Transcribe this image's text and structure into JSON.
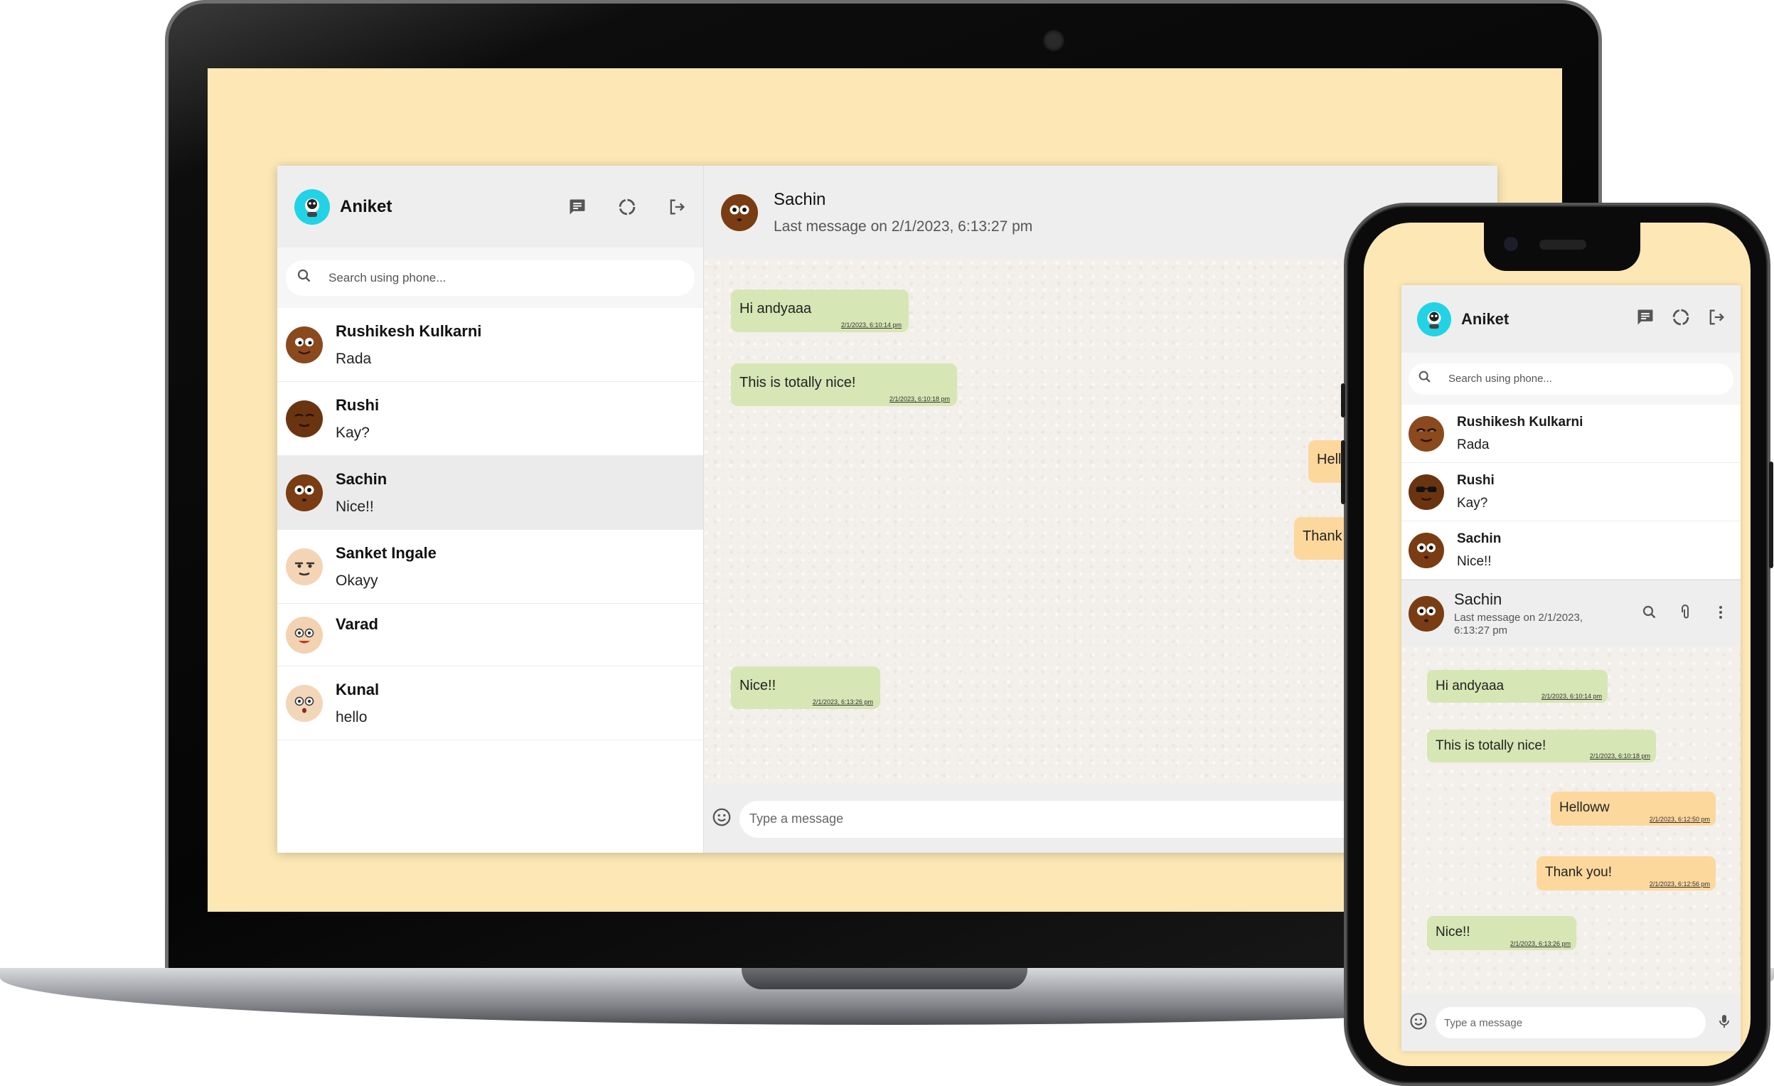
{
  "app": {
    "user_name": "Aniket",
    "search_placeholder": "Search using phone...",
    "message_placeholder": "Type a message",
    "header_icons": [
      "new-chat-icon",
      "status-icon",
      "logout-icon"
    ]
  },
  "desktop": {
    "chats": [
      {
        "name": "Rushikesh Kulkarni",
        "last": "Rada"
      },
      {
        "name": "Rushi",
        "last": "Kay?"
      },
      {
        "name": "Sachin",
        "last": "Nice!!"
      },
      {
        "name": "Sanket Ingale",
        "last": "Okayy"
      },
      {
        "name": "Varad",
        "last": ""
      },
      {
        "name": "Kunal",
        "last": "hello"
      }
    ],
    "conversation": {
      "name": "Sachin",
      "subtitle": "Last message on 2/1/2023, 6:13:27 pm",
      "messages": [
        {
          "text": "Hi andyaaa",
          "time": "2/1/2023, 6:10:14 pm"
        },
        {
          "text": "This is totally nice!",
          "time": "2/1/2023, 6:10:18 pm"
        },
        {
          "text": "Hell",
          "time": ""
        },
        {
          "text": "Thank y",
          "time": ""
        },
        {
          "text": "Nice!!",
          "time": "2/1/2023, 6:13:26 pm"
        }
      ]
    }
  },
  "mobile": {
    "chats": [
      {
        "name": "Rushikesh Kulkarni",
        "last": "Rada"
      },
      {
        "name": "Rushi",
        "last": "Kay?"
      },
      {
        "name": "Sachin",
        "last": "Nice!!"
      }
    ],
    "conversation": {
      "name": "Sachin",
      "subtitle": "Last message on 2/1/2023, 6:13:27 pm",
      "messages": [
        {
          "text": "Hi andyaaa",
          "time": "2/1/2023, 6:10:14 pm"
        },
        {
          "text": "This is totally nice!",
          "time": "2/1/2023, 6:10:18 pm"
        },
        {
          "text": "Helloww",
          "time": "2/1/2023, 6:12:50 pm"
        },
        {
          "text": "Thank you!",
          "time": "2/1/2023, 6:12:56 pm"
        },
        {
          "text": "Nice!!",
          "time": "2/1/2023, 6:13:26 pm"
        }
      ]
    }
  },
  "colors": {
    "background": "#fde8b5",
    "incoming_bubble": "#d6e6b4",
    "outgoing_bubble": "#fdd89d",
    "header": "#eeeeee",
    "avatar_ring": "#22d3e6"
  }
}
